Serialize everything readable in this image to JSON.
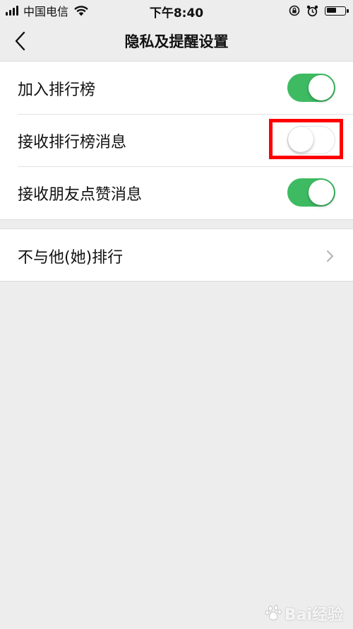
{
  "status_bar": {
    "carrier": "中国电信",
    "time": "下午8:40",
    "battery_level": 0.55
  },
  "nav": {
    "title": "隐私及提醒设置"
  },
  "settings": [
    {
      "label": "加入排行榜",
      "on": true
    },
    {
      "label": "接收排行榜消息",
      "on": false
    },
    {
      "label": "接收朋友点赞消息",
      "on": true
    }
  ],
  "link_row": {
    "label": "不与他(她)排行"
  },
  "watermark": {
    "text": "Bai经验"
  },
  "colors": {
    "switch_on": "#3ebb62",
    "highlight": "#ff0000",
    "background": "#ededed"
  }
}
